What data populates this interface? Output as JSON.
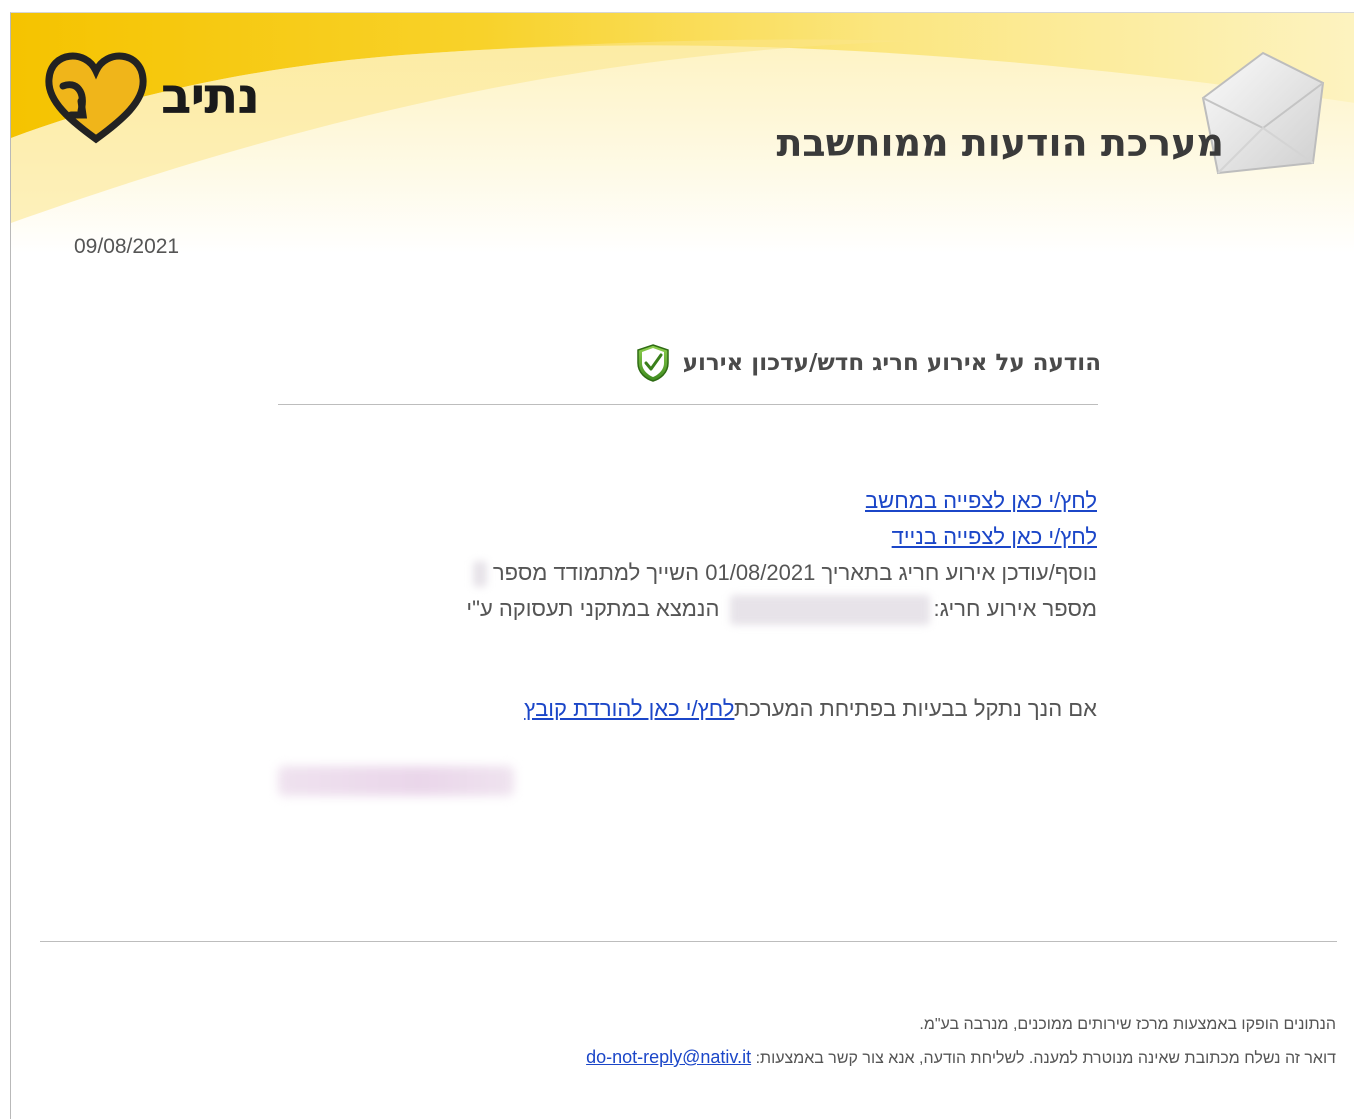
{
  "header": {
    "logo_text": "נתיב",
    "system_title": "מערכת הודעות ממוחשבת"
  },
  "date": "09/08/2021",
  "notice": {
    "title": "הודעה על אירוע חריג חדש/עדכון אירוע"
  },
  "links": {
    "view_computer": "לחץ/י כאן לצפייה במחשב",
    "view_mobile": "לחץ/י כאן לצפייה בנייד",
    "download_file": "לחץ/י כאן להורדת קובץ"
  },
  "body": {
    "event_line_prefix": "נוסף/עודכן אירוע חריג בתאריך",
    "event_date": "01/08/2021",
    "event_line_suffix": "השייך למתמודד מספר",
    "event_number_label": "מספר אירוע חריג:",
    "located_text": "הנמצא במתקני תעסוקה ע\"י",
    "problem_text": "אם הנך נתקל בבעיות בפתיחת המערכת"
  },
  "footer": {
    "line1": "הנתונים הופקו באמצעות מרכז שירותים ממוכנים, מנרבה בע\"מ.",
    "line2_text": "דואר זה נשלח מכתובת שאינה מנוטרת למענה. לשליחת הודעה, אנא צור קשר באמצעות:",
    "email": "do-not-reply@nativ.it"
  },
  "colors": {
    "link": "#1b46c8",
    "header_yellow": "#f7c800",
    "text": "#555555"
  }
}
